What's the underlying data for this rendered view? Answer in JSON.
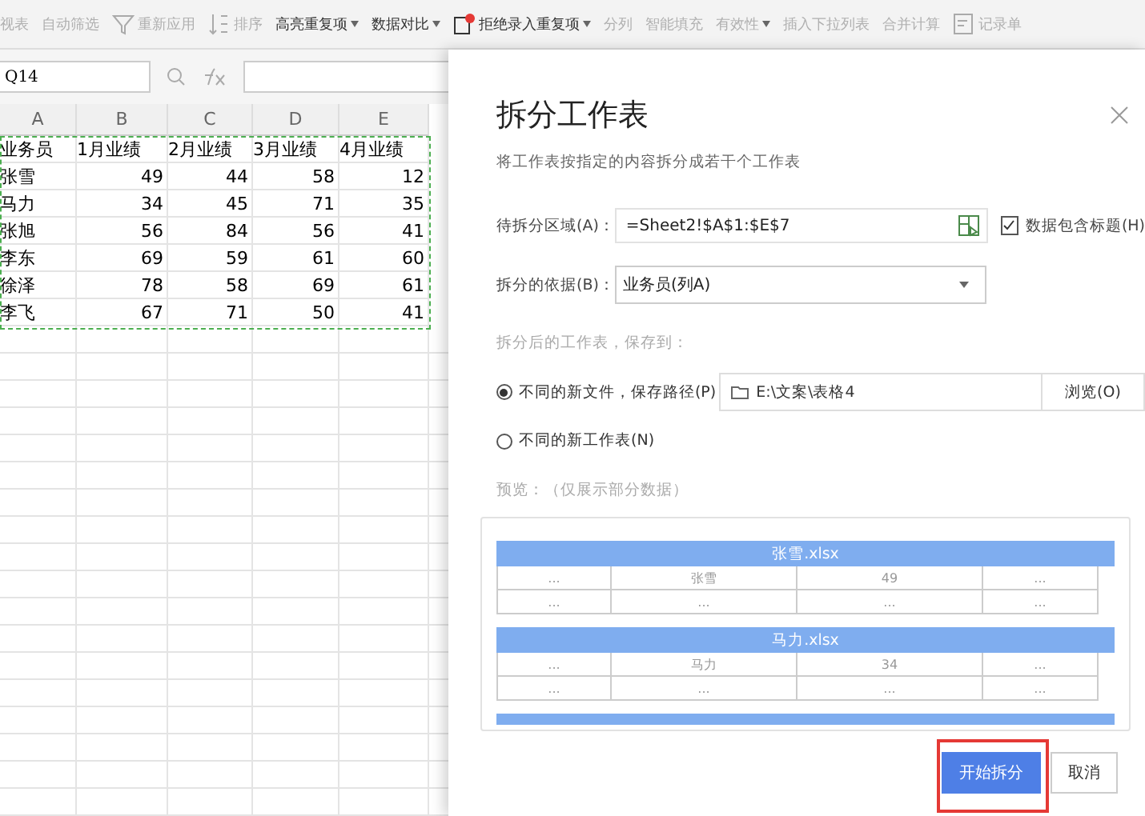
{
  "toolbar": [
    {
      "label": "视表",
      "disabled": true,
      "dropdown": false
    },
    {
      "label": "自动筛选",
      "disabled": true,
      "dropdown": false
    },
    {
      "label": "重新应用",
      "disabled": true,
      "dropdown": false
    },
    {
      "label": "排序",
      "disabled": true,
      "dropdown": false
    },
    {
      "label": "高亮重复项",
      "disabled": false,
      "dropdown": true
    },
    {
      "label": "数据对比",
      "disabled": false,
      "dropdown": true
    },
    {
      "label": "拒绝录入重复项",
      "disabled": false,
      "dropdown": true
    },
    {
      "label": "分列",
      "disabled": true,
      "dropdown": false
    },
    {
      "label": "智能填充",
      "disabled": true,
      "dropdown": false
    },
    {
      "label": "有效性",
      "disabled": true,
      "dropdown": true
    },
    {
      "label": "插入下拉列表",
      "disabled": true,
      "dropdown": false
    },
    {
      "label": "合并计算",
      "disabled": true,
      "dropdown": false
    },
    {
      "label": "记录单",
      "disabled": true,
      "dropdown": false
    }
  ],
  "name_box": "Q14",
  "sheet": {
    "columns": [
      "A",
      "B",
      "C",
      "D",
      "E"
    ],
    "rows": [
      [
        "业务员",
        "1月业绩",
        "2月业绩",
        "3月业绩",
        "4月业绩"
      ],
      [
        "张雪",
        "49",
        "44",
        "58",
        "12"
      ],
      [
        "马力",
        "34",
        "45",
        "71",
        "35"
      ],
      [
        "张旭",
        "56",
        "84",
        "56",
        "41"
      ],
      [
        "李东",
        "69",
        "59",
        "61",
        "60"
      ],
      [
        "徐泽",
        "78",
        "58",
        "69",
        "61"
      ],
      [
        "李飞",
        "67",
        "71",
        "50",
        "41"
      ]
    ]
  },
  "dialog": {
    "title": "拆分工作表",
    "subtitle": "将工作表按指定的内容拆分成若干个工作表",
    "range_label": "待拆分区域(A)：",
    "range_value": "=Sheet2!$A$1:$E$7",
    "header_checkbox": {
      "label": "数据包含标题(H)",
      "checked": true
    },
    "basis_label": "拆分的依据(B)：",
    "basis_value": "业务员(列A)",
    "save_label": "拆分后的工作表，保存到：",
    "options": [
      {
        "kind": "path",
        "label": "不同的新文件，保存路径(P)",
        "selected": true,
        "path": "E:\\文案\\表格4",
        "browse": "浏览(O)"
      },
      {
        "kind": "plain",
        "label": "不同的新工作表(N)",
        "selected": false
      }
    ],
    "preview_label": "预览：（仅展示部分数据）",
    "preview": [
      {
        "title": "张雪.xlsx",
        "rows": [
          [
            "...",
            "张雪",
            "49",
            "..."
          ],
          [
            "...",
            "...",
            "...",
            "..."
          ]
        ]
      },
      {
        "title": "马力.xlsx",
        "rows": [
          [
            "...",
            "马力",
            "34",
            "..."
          ],
          [
            "...",
            "...",
            "...",
            "..."
          ]
        ]
      }
    ],
    "buttons": [
      {
        "label": "开始拆分",
        "kind": "primary"
      },
      {
        "label": "取消",
        "kind": "secondary"
      }
    ]
  }
}
